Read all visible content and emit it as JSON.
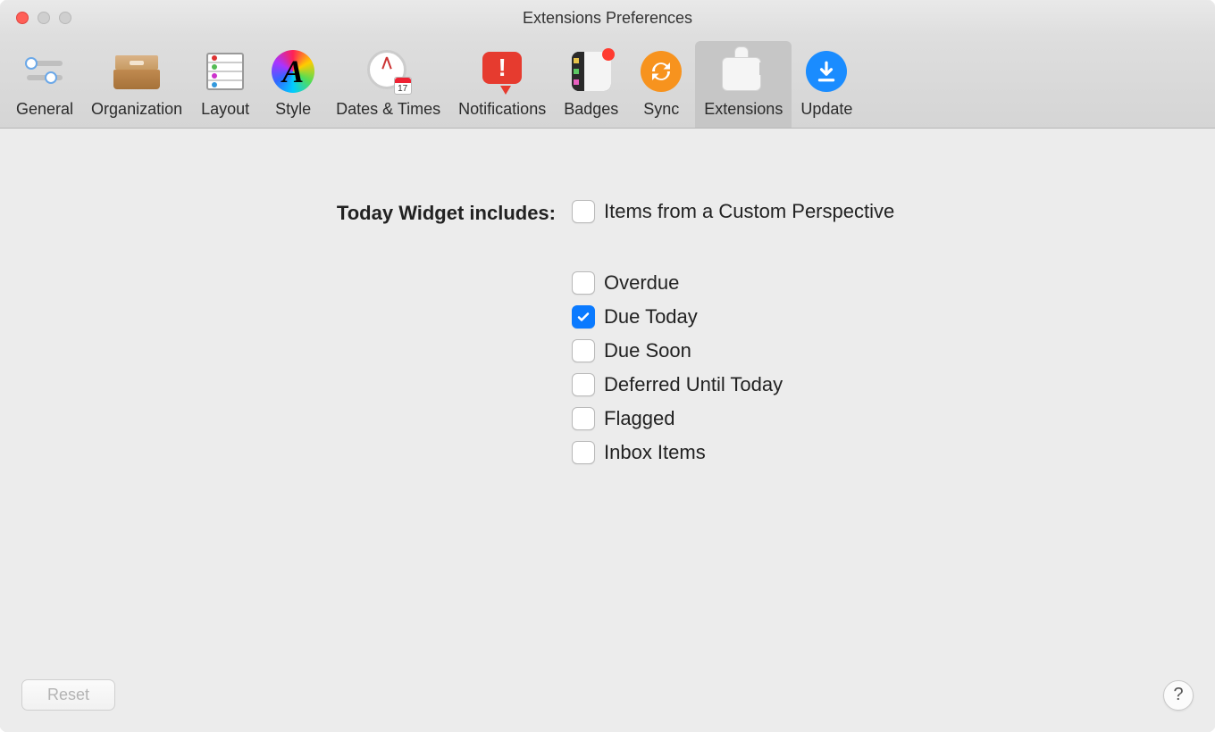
{
  "window": {
    "title": "Extensions Preferences"
  },
  "toolbar": {
    "tabs": [
      {
        "id": "general",
        "label": "General"
      },
      {
        "id": "organization",
        "label": "Organization"
      },
      {
        "id": "layout",
        "label": "Layout"
      },
      {
        "id": "style",
        "label": "Style"
      },
      {
        "id": "dates",
        "label": "Dates & Times"
      },
      {
        "id": "notifications",
        "label": "Notifications"
      },
      {
        "id": "badges",
        "label": "Badges"
      },
      {
        "id": "sync",
        "label": "Sync"
      },
      {
        "id": "extensions",
        "label": "Extensions"
      },
      {
        "id": "update",
        "label": "Update"
      }
    ],
    "active": "extensions",
    "cal_day": "17"
  },
  "section": {
    "label": "Today Widget includes:",
    "options": [
      {
        "id": "custom",
        "label": "Items from a Custom Perspective",
        "checked": false
      },
      {
        "id": "overdue",
        "label": "Overdue",
        "checked": false
      },
      {
        "id": "due_today",
        "label": "Due Today",
        "checked": true
      },
      {
        "id": "due_soon",
        "label": "Due Soon",
        "checked": false
      },
      {
        "id": "deferred",
        "label": "Deferred Until Today",
        "checked": false
      },
      {
        "id": "flagged",
        "label": "Flagged",
        "checked": false
      },
      {
        "id": "inbox",
        "label": "Inbox Items",
        "checked": false
      }
    ]
  },
  "footer": {
    "reset": "Reset",
    "help": "?"
  }
}
